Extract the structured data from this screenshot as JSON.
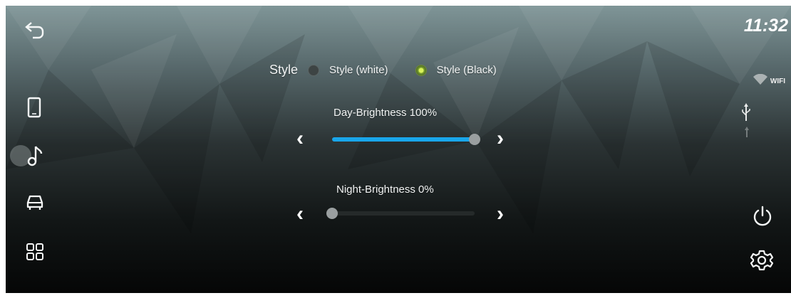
{
  "clock": {
    "time": "11:32"
  },
  "status": {
    "wifi_label": "WIFI"
  },
  "style": {
    "label": "Style",
    "options": [
      {
        "label": "Style (white)",
        "checked": false
      },
      {
        "label": "Style (Black)",
        "checked": true
      }
    ]
  },
  "day_brightness": {
    "label": "Day-Brightness 100%",
    "value_fraction": 1.0
  },
  "night_brightness": {
    "label": "Night-Brightness 0%",
    "value_fraction": 0.0
  },
  "icons": {
    "left": [
      "back-icon",
      "phone-icon",
      "music-note-icon",
      "car-icon",
      "apps-grid-icon"
    ],
    "right": [
      "wifi-icon",
      "usb-icon",
      "power-icon",
      "settings-gear-icon"
    ]
  },
  "colors": {
    "accent": "#19a6ea",
    "radio_checked": "#b5d943"
  }
}
